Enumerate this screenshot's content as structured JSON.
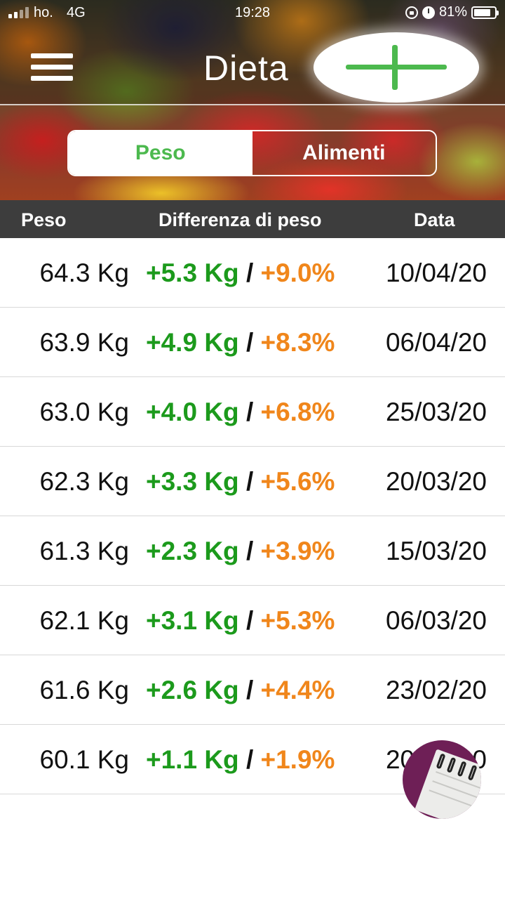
{
  "status_bar": {
    "carrier": "ho.",
    "network": "4G",
    "time": "19:28",
    "battery": "81%",
    "battery_level": 0.81
  },
  "header": {
    "title": "Dieta",
    "add_icon": "plus-icon",
    "menu_icon": "hamburger-menu-icon"
  },
  "tabs": [
    {
      "label": "Peso",
      "active": true
    },
    {
      "label": "Alimenti",
      "active": false
    }
  ],
  "table": {
    "columns": [
      "Peso",
      "Differenza di peso",
      "Data"
    ],
    "rows": [
      {
        "weight": "64.3 Kg",
        "diff_kg": "+5.3 Kg",
        "sep": "/",
        "diff_pct": "+9.0%",
        "date": "10/04/20"
      },
      {
        "weight": "63.9 Kg",
        "diff_kg": "+4.9 Kg",
        "sep": "/",
        "diff_pct": "+8.3%",
        "date": "06/04/20"
      },
      {
        "weight": "63.0 Kg",
        "diff_kg": "+4.0 Kg",
        "sep": "/",
        "diff_pct": "+6.8%",
        "date": "25/03/20"
      },
      {
        "weight": "62.3 Kg",
        "diff_kg": "+3.3 Kg",
        "sep": "/",
        "diff_pct": "+5.6%",
        "date": "20/03/20"
      },
      {
        "weight": "61.3 Kg",
        "diff_kg": "+2.3 Kg",
        "sep": "/",
        "diff_pct": "+3.9%",
        "date": "15/03/20"
      },
      {
        "weight": "62.1 Kg",
        "diff_kg": "+3.1 Kg",
        "sep": "/",
        "diff_pct": "+5.3%",
        "date": "06/03/20"
      },
      {
        "weight": "61.6 Kg",
        "diff_kg": "+2.6 Kg",
        "sep": "/",
        "diff_pct": "+4.4%",
        "date": "23/02/20"
      },
      {
        "weight": "60.1 Kg",
        "diff_kg": "+1.1 Kg",
        "sep": "/",
        "diff_pct": "+1.9%",
        "date": "20/02/20"
      }
    ]
  },
  "fab": {
    "icon": "notebook-icon"
  },
  "colors": {
    "accent_green": "#4cb94e",
    "kg_green": "#1c9a1c",
    "pct_orange": "#f0861b",
    "header_dark": "#3d3d3d",
    "fab_purple": "#6e1f56"
  }
}
